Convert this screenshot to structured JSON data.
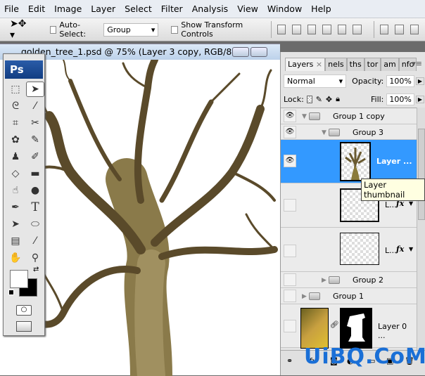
{
  "menu": [
    "File",
    "Edit",
    "Image",
    "Layer",
    "Select",
    "Filter",
    "Analysis",
    "View",
    "Window",
    "Help"
  ],
  "options": {
    "auto_select_label": "Auto-Select:",
    "auto_select_value": "Group",
    "show_transform_label": "Show Transform Controls"
  },
  "document": {
    "title": "golden_tree_1.psd @ 75% (Layer 3 copy, RGB/8)"
  },
  "toolbox": {
    "logo": "Ps"
  },
  "layers_panel": {
    "tabs": [
      "Layers",
      "nels",
      "ths",
      "tor",
      "am",
      "nfo"
    ],
    "blend_mode": "Normal",
    "opacity_label": "Opacity:",
    "opacity": "100%",
    "lock_label": "Lock:",
    "fill_label": "Fill:",
    "fill": "100%",
    "layers": [
      {
        "name": "Group 1 copy",
        "type": "group",
        "visible": true,
        "expanded": true
      },
      {
        "name": "Group 3",
        "type": "group",
        "visible": true,
        "expanded": true
      },
      {
        "name": "Layer ...",
        "type": "layer",
        "visible": true,
        "selected": true
      },
      {
        "name": "L...",
        "type": "layer",
        "visible": false,
        "fx": "fx"
      },
      {
        "name": "L...",
        "type": "layer",
        "visible": false,
        "fx": "fx"
      },
      {
        "name": "Group 2",
        "type": "group",
        "visible": false,
        "expanded": false
      },
      {
        "name": "Group 1",
        "type": "group",
        "visible": false,
        "expanded": false
      },
      {
        "name": "Layer 0 ...",
        "type": "layer",
        "visible": false,
        "mask": true
      }
    ],
    "tooltip": "Layer thumbnail",
    "selected_color": "#3399ff"
  },
  "watermark": "UiBQ.CoM"
}
